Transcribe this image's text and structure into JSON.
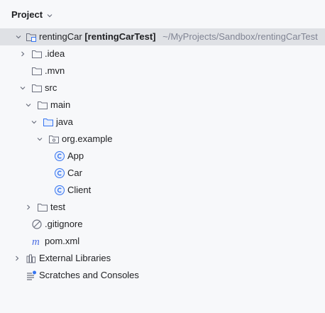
{
  "panel": {
    "title": "Project"
  },
  "tree": {
    "root": {
      "name": "rentingCar",
      "module": "[rentingCarTest]",
      "path": "~/MyProjects/Sandbox/rentingCarTest"
    },
    "idea": ".idea",
    "mvn": ".mvn",
    "src": "src",
    "main": "main",
    "java": "java",
    "package": "org.example",
    "classes": [
      "App",
      "Car",
      "Client"
    ],
    "test": "test",
    "gitignore": ".gitignore",
    "pom": "pom.xml",
    "external_libraries": "External Libraries",
    "scratches": "Scratches and Consoles"
  },
  "colors": {
    "selection": "#dfe1e5",
    "class_icon": "#3574f0",
    "maven_icon": "#4d6ee3",
    "muted_text": "#818594"
  }
}
